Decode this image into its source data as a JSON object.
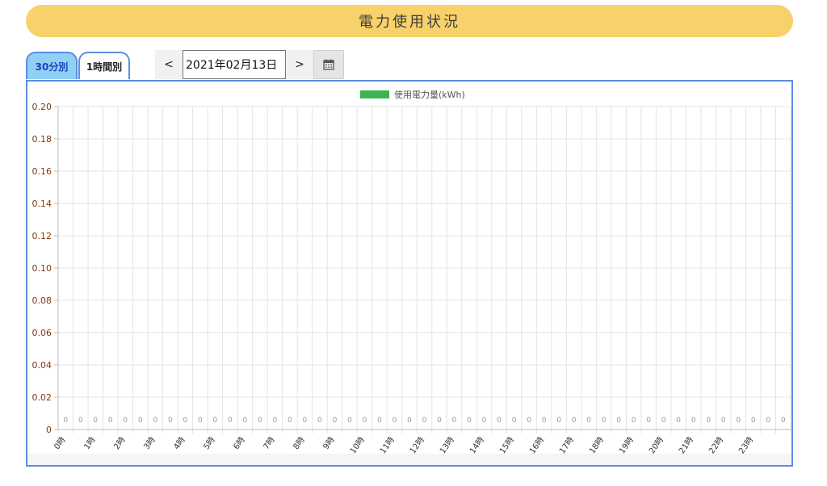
{
  "header": {
    "title": "電力使用状況"
  },
  "tabs": [
    {
      "label": "30分別",
      "active": true
    },
    {
      "label": "1時間別",
      "active": false
    }
  ],
  "date_nav": {
    "prev_label": "<",
    "next_label": ">",
    "date_value": "2021年02月13日",
    "calendar_icon": "calendar-icon"
  },
  "colors": {
    "header_bg": "#f7d26a",
    "tab_active_bg": "#8fd0f6",
    "panel_border": "#5b8ee0",
    "series_color": "#3cb551",
    "y_tick_color": "#7a3b14"
  },
  "chart_data": {
    "type": "bar",
    "legend": "使用電力量(kWh)",
    "legend_position": "top",
    "grid": true,
    "ylim": [
      0,
      0.2
    ],
    "y_ticks": [
      "0",
      "0.02",
      "0.04",
      "0.06",
      "0.08",
      "0.10",
      "0.12",
      "0.14",
      "0.16",
      "0.18",
      "0.20"
    ],
    "x_labels": [
      "0時",
      "1時",
      "2時",
      "3時",
      "4時",
      "5時",
      "6時",
      "7時",
      "8時",
      "9時",
      "10時",
      "11時",
      "12時",
      "13時",
      "14時",
      "15時",
      "16時",
      "17時",
      "18時",
      "19時",
      "20時",
      "21時",
      "22時",
      "23時"
    ],
    "series": [
      {
        "name": "使用電力量(kWh)",
        "values": [
          0,
          0,
          0,
          0,
          0,
          0,
          0,
          0,
          0,
          0,
          0,
          0,
          0,
          0,
          0,
          0,
          0,
          0,
          0,
          0,
          0,
          0,
          0,
          0,
          0,
          0,
          0,
          0,
          0,
          0,
          0,
          0,
          0,
          0,
          0,
          0,
          0,
          0,
          0,
          0,
          0,
          0,
          0,
          0,
          0,
          0,
          0,
          0,
          0
        ]
      }
    ]
  }
}
